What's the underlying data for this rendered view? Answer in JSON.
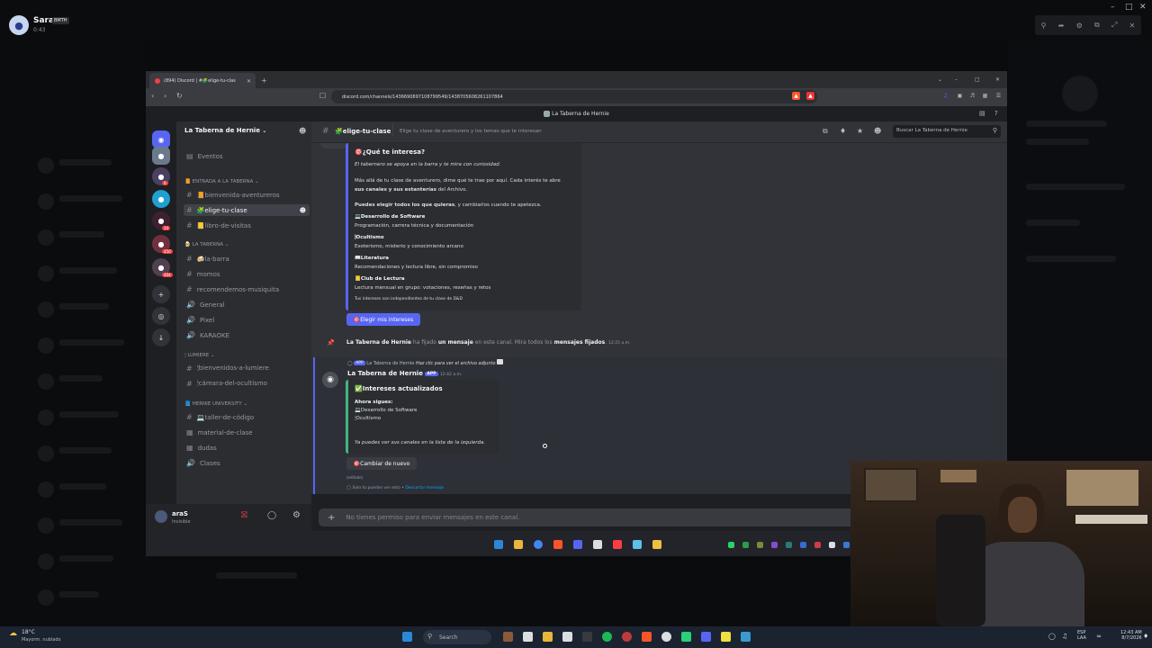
{
  "desktop": {
    "owner_name": "Sara",
    "owner_badge": "BMTH",
    "owner_time": "0:43",
    "window_controls": [
      "–",
      "□",
      "✕"
    ]
  },
  "browser": {
    "tab_title": "(894) Discord | #🧩elige-tu-clas",
    "url": "discord.com/channels/1436690897108799549/1438705608261107864",
    "window_controls": [
      "⌄",
      "–",
      "□",
      "✕"
    ]
  },
  "discord": {
    "window_title": "La Taberna de Hernie",
    "server_name": "La Taberna de Hernie",
    "events_label": "Eventos",
    "guild_badges": [
      "6",
      "34",
      "450",
      "404"
    ],
    "categories": [
      {
        "label": "ENTRADA A LA TABERNA",
        "channels": [
          "📙bienvenida-aventureros",
          "🧩elige-tu-clase",
          "📒libro-de-visitas"
        ]
      },
      {
        "label": "LA TABERNA",
        "channels": [
          "🍻la-barra",
          "momos",
          "recomendemos-musiquita",
          "General",
          "Pixel",
          "KARAOKE"
        ]
      },
      {
        "label": "LUMIERE",
        "channels": [
          "🕯bienvenidos-a-lumiere",
          "🕯cámara-del-ocultismo"
        ]
      },
      {
        "label": "HERNIE UNIVERSITY",
        "channels": [
          "💻taller-de-código",
          "material-de-clase",
          "dudas",
          "Clases"
        ]
      }
    ],
    "channel_header": {
      "name": "elige-tu-clase",
      "topic": "Elige tu clase de aventurero y los temas que te interesan",
      "search_placeholder": "Buscar La Taberna de Hernie"
    },
    "user": {
      "name": "araS",
      "status": "Invisible"
    },
    "embed1": {
      "title": "🎯¿Qué te interesa?",
      "italic": "El tabernero se apoya en la barra y te mira con curiosidad.",
      "para1": "Más allá de tu clase de aventurero, dime qué te trae por aquí. Cada interés te abre",
      "para1b_bold": "sus canales y sus estanterías",
      "para1b_rest": "del Archivo.",
      "para2_bold": "Puedes elegir todos los que quieras",
      "para2_rest": ", y cambiarlos cuando te apetezca.",
      "items": [
        {
          "title": "💻Desarrollo de Software",
          "desc": "Programación, carrera técnica y documentación"
        },
        {
          "title": "🕯Ocultismo",
          "desc": "Esoterismo, misterio y conocimiento arcano"
        },
        {
          "title": "📖Literatura",
          "desc": "Recomendaciones y lectura libre, sin compromiso"
        },
        {
          "title": "📒Club de Lectura",
          "desc": "Lectura mensual en grupo: votaciones, reseñas y retos"
        }
      ],
      "footer": "Tus intereses son independientes de tu clase de D&D",
      "button": "🎯Elegir mis intereses"
    },
    "pin_msg": {
      "author": "La Taberna de Hernie",
      "t1": "ha fijado",
      "t2": "un mensaje",
      "t3": "en este canal. Mira todos los",
      "t4": "mensajes fijados",
      "t5": ".",
      "time": "12:25 a.m."
    },
    "reply_line": {
      "tag": "APP",
      "author": "La Taberna de Hernie",
      "text": "Haz clic para ver el archivo adjunto"
    },
    "msg2": {
      "author": "La Taberna de Hernie",
      "tag": "APP",
      "time": "12:42 a.m.",
      "embed_title": "✅Intereses actualizados",
      "now_following": "Ahora sigues:",
      "following": [
        "💻Desarrollo de Software",
        "🕯Ocultismo"
      ],
      "footer": "Ya puedes ver sus canales en la lista de la izquierda.",
      "button": "🎯Cambiar de nuevo",
      "edited": "(editado)",
      "ephemeral": "Solo tú puedes ver esto •",
      "dismiss": "Descartar mensaje"
    },
    "composer_placeholder": "No tienes permiso para enviar mensajes en este canal."
  },
  "os": {
    "weather_temp": "18°C",
    "weather_desc": "Mayorm. nublado",
    "search": "Search",
    "lang1": "ESP",
    "lang2": "LAA",
    "time": "12:43 AM",
    "date": "8/7/2026"
  }
}
